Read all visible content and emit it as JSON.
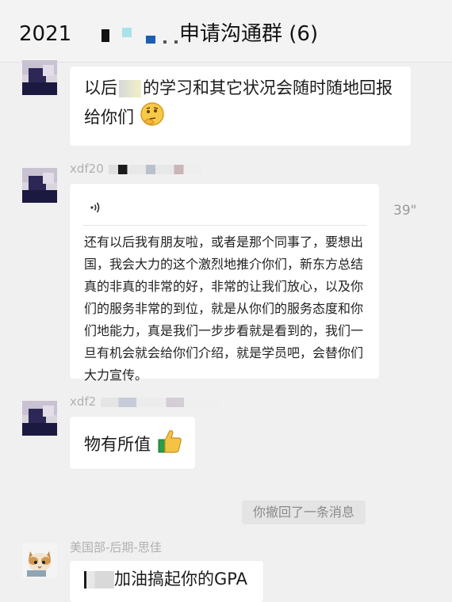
{
  "header": {
    "year": "2021",
    "title_suffix": "申请沟通群 (6)"
  },
  "messages": [
    {
      "text_prefix": "以后",
      "text_rest_line1": "的学习和其它状况会随时随地回报",
      "text_line2": "给你们",
      "emoji": "thinking-face-icon"
    },
    {
      "sender": "xdf20",
      "voice_duration": "39\"",
      "transcript": "还有以后我有朋友啦，或者是那个同事了，要想出国，我会大力的这个激烈地推介你们，新东方总结真的非真的非常的好，非常的让我们放心，以及你们的服务非常的到位，就是从你们的服务态度和你们地能力，真是我们一步步看就是看到的，我们一旦有机会就会给你们介绍，就是学员吧，会替你们大力宣传。"
    },
    {
      "sender": "xdf2",
      "text": "物有所值",
      "emoji": "thumbs-up-icon"
    },
    {
      "system_notice": "你撤回了一条消息"
    },
    {
      "sender": "美国部-后期-思佳",
      "text": "加油搞起你的GPA"
    }
  ]
}
